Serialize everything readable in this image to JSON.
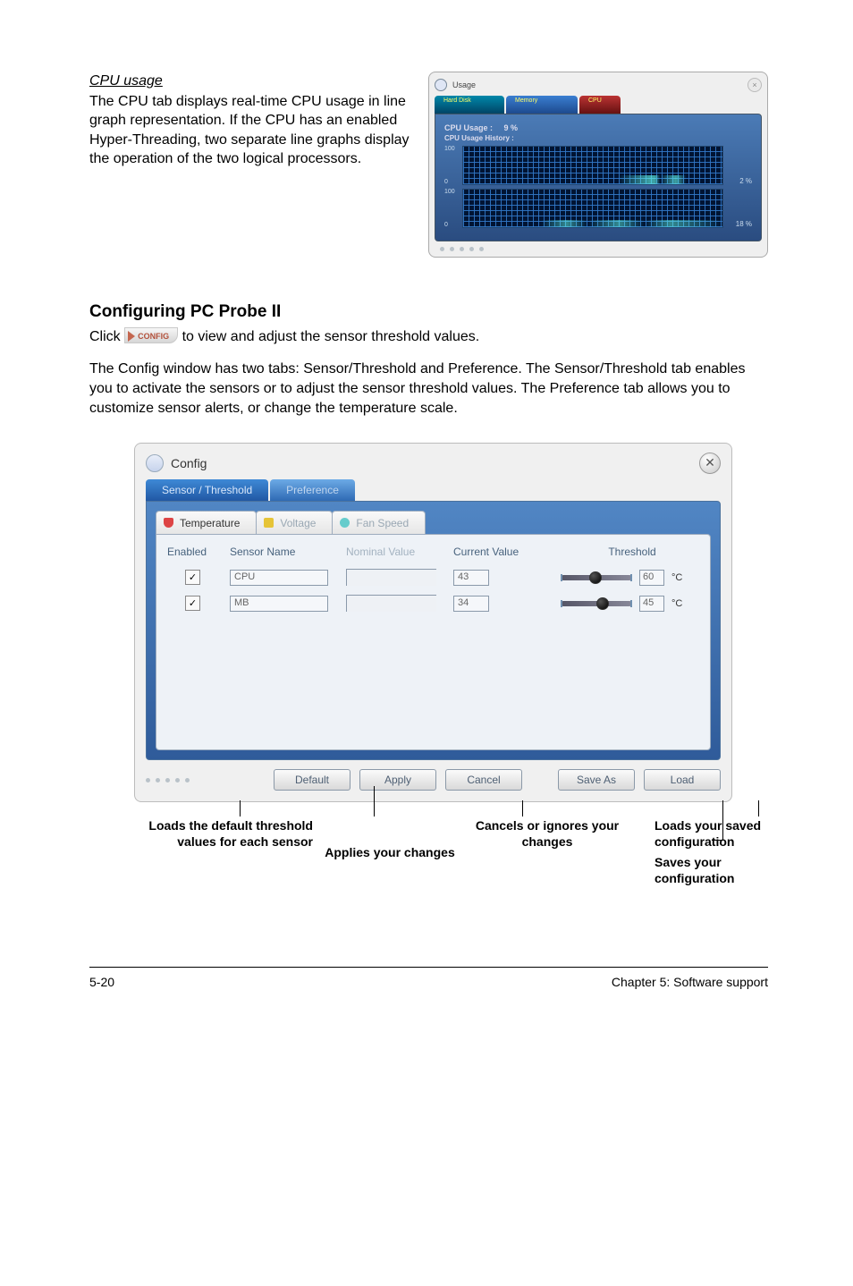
{
  "cpu_section": {
    "title": "CPU usage",
    "body": "The CPU tab displays real-time CPU usage in line graph representation. If the CPU has an enabled Hyper-Threading, two separate line graphs display the operation of the two logical processors.",
    "fig": {
      "window_title": "Usage",
      "tabs": [
        "Hard Disk",
        "Memory",
        "CPU"
      ],
      "label1": "CPU Usage :",
      "label1_val": "9 %",
      "label2": "CPU Usage History :",
      "axis_top": "100",
      "axis_bot": "0",
      "pct1": "2 %",
      "pct2": "18 %"
    }
  },
  "config": {
    "heading": "Configuring PC Probe II",
    "click_pre": "Click ",
    "chip_label": "CONFIG",
    "click_post": " to view and adjust the sensor threshold values.",
    "para": "The Config window has two tabs: Sensor/Threshold and Preference. The Sensor/Threshold tab enables you to activate the sensors or to adjust the sensor threshold values. The Preference tab allows you to customize sensor alerts, or change the temperature scale.",
    "window": {
      "title": "Config",
      "tab_sensor": "Sensor / Threshold",
      "tab_pref": "Preference",
      "tab_temp": "Temperature",
      "tab_volt": "Voltage",
      "tab_fan": "Fan Speed",
      "hdr_enabled": "Enabled",
      "hdr_sensor": "Sensor Name",
      "hdr_nominal": "Nominal Value",
      "hdr_current": "Current Value",
      "hdr_thresh": "Threshold",
      "rows": [
        {
          "name": "CPU",
          "current": "43",
          "thresh": "60",
          "unit": "°C",
          "knob": 40
        },
        {
          "name": "MB",
          "current": "34",
          "thresh": "45",
          "unit": "°C",
          "knob": 50
        }
      ],
      "btn_default": "Default",
      "btn_apply": "Apply",
      "btn_cancel": "Cancel",
      "btn_saveas": "Save As",
      "btn_load": "Load"
    },
    "callouts": {
      "c1": "Loads the default threshold values for each sensor",
      "c2": "Applies your changes",
      "c3": "Cancels or ignores your changes",
      "c4a": "Loads your saved configuration",
      "c4b": "Saves your configuration"
    }
  },
  "footer": {
    "left": "5-20",
    "right": "Chapter 5: Software support"
  }
}
